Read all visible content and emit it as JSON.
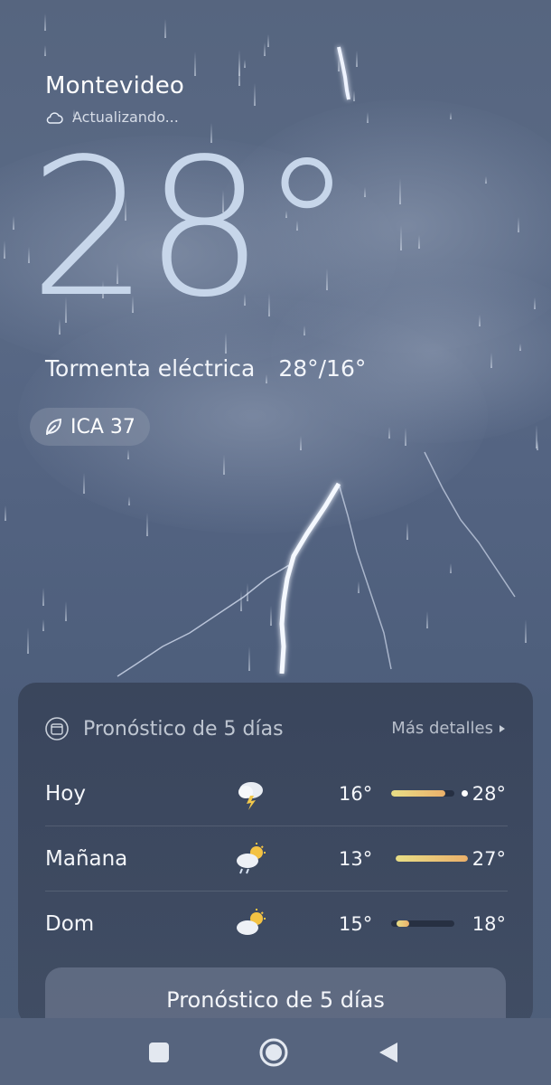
{
  "location": {
    "city": "Montevideo",
    "status": "Actualizando..."
  },
  "current": {
    "temperature": "28°",
    "condition": "Tormenta eléctrica",
    "high_low": "28°/16°",
    "aqi_label": "ICA 37"
  },
  "forecast": {
    "title": "Pronóstico de 5 días",
    "more_label": "Más detalles",
    "days": [
      {
        "name": "Hoy",
        "icon": "thunderstorm-icon",
        "low": "16°",
        "high": "28°",
        "bar_start": 0.0,
        "bar_end": 0.86,
        "marker": 0.86
      },
      {
        "name": "Mañana",
        "icon": "partly-sunny-rain-icon",
        "low": "13°",
        "high": "27°",
        "bar_start": 0.0,
        "bar_end": 1.0
      },
      {
        "name": "Dom",
        "icon": "partly-cloudy-icon",
        "low": "15°",
        "high": "18°",
        "bar_start": 0.08,
        "bar_end": 0.28
      }
    ],
    "cta_label": "Pronóstico de 5 días"
  },
  "colors": {
    "bar_start": "#e8de86",
    "bar_end": "#ebb06a",
    "temperature": "#c7d6ea"
  },
  "navigation": {
    "buttons": [
      "recents-button",
      "home-button",
      "back-button"
    ]
  }
}
